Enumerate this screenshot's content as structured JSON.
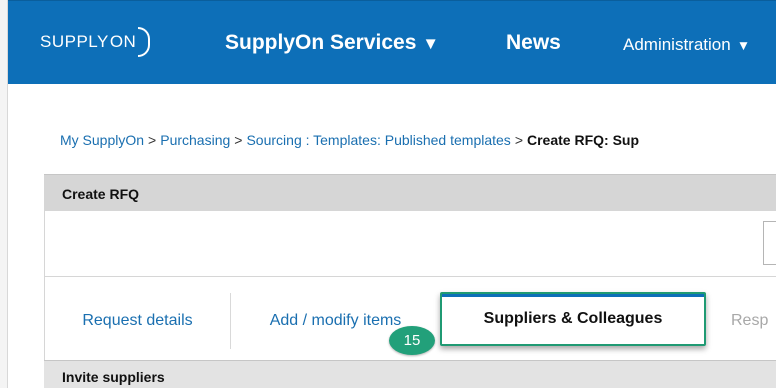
{
  "header": {
    "logo_text": "SUPPLYON",
    "logo_prefix": "SUPPLY",
    "logo_suffix": "ON",
    "nav": {
      "services": "SupplyOn Services",
      "news": "News",
      "administration": "Administration"
    },
    "caret": "▼",
    "colors": {
      "bar": "#0d6fb8"
    }
  },
  "breadcrumb": {
    "items": [
      "My SupplyOn",
      "Purchasing",
      "Sourcing : Templates: Published templates"
    ],
    "separator": ">",
    "current": "Create RFQ: Sup"
  },
  "panel": {
    "title": "Create RFQ"
  },
  "tabs": {
    "request_details": "Request details",
    "add_modify_items": "Add / modify items",
    "suppliers_colleagues": "Suppliers & Colleagues",
    "responses": "Resp"
  },
  "annotation": {
    "step_number": "15",
    "color": "#22a07a"
  },
  "section": {
    "title": "Invite suppliers"
  }
}
